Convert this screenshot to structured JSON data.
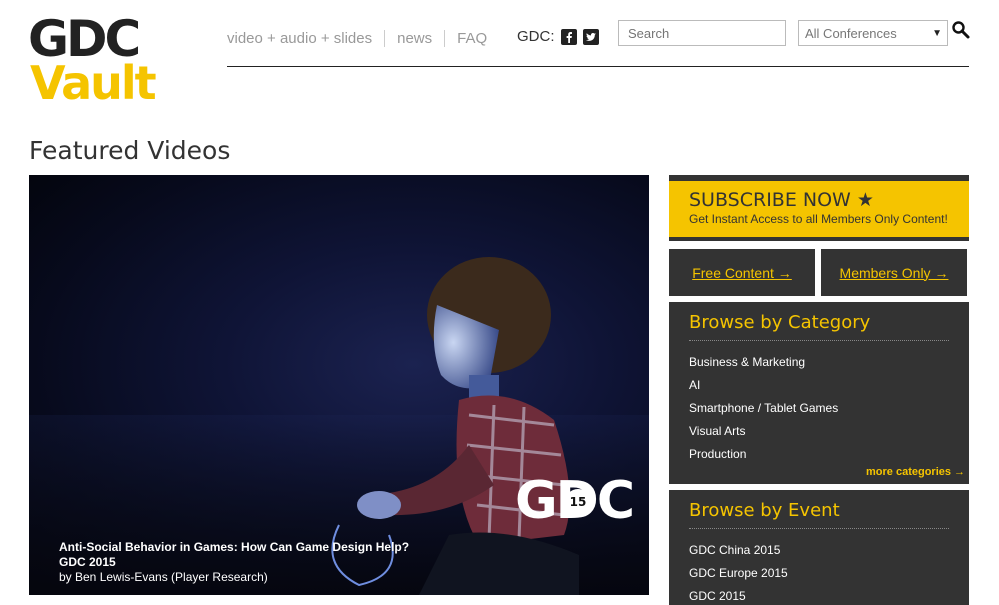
{
  "logo": {
    "line1": "GDC",
    "line2": "Vault"
  },
  "nav": {
    "items": [
      "video + audio + slides",
      "news",
      "FAQ"
    ],
    "social_label": "GDC:",
    "social_icons": [
      "facebook-icon",
      "twitter-icon"
    ]
  },
  "search": {
    "placeholder": "Search",
    "icon": "magnifier-icon"
  },
  "conference_select": {
    "selected": "All Conferences"
  },
  "main": {
    "section_title": "Featured Videos",
    "hero": {
      "title": "Anti-Social Behavior in Games: How Can Game Design Help?",
      "event": "GDC 2015",
      "byline": "by Ben Lewis-Evans (Player Research)",
      "watermark": "GDC",
      "badge": "15"
    }
  },
  "sidebar": {
    "subscribe": {
      "title": "SUBSCRIBE NOW ★",
      "subtitle": "Get Instant Access to all Members Only Content!"
    },
    "free_content": "Free Content →",
    "members_only": "Members Only →",
    "browse_category": {
      "title": "Browse by Category",
      "items": [
        "Business & Marketing",
        "AI",
        "Smartphone / Tablet Games",
        "Visual Arts",
        "Production"
      ],
      "more": "more categories →"
    },
    "browse_event": {
      "title": "Browse by Event",
      "items": [
        "GDC China 2015",
        "GDC Europe 2015",
        "GDC 2015"
      ]
    }
  },
  "colors": {
    "accent": "#f5c400",
    "dark": "#333333"
  }
}
